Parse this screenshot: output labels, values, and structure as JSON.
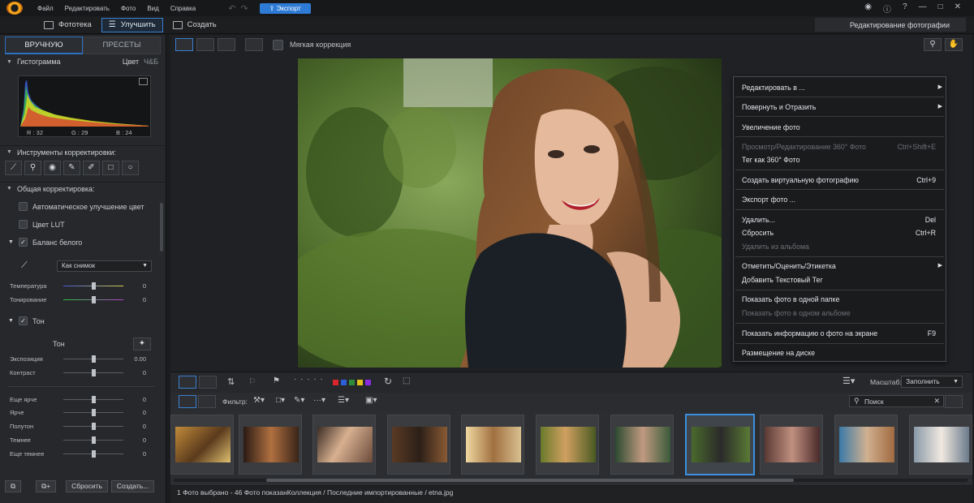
{
  "menu": [
    "Файл",
    "Редактировать",
    "Фото",
    "Вид",
    "Справка"
  ],
  "export_label": "Экспорт",
  "modes": {
    "library": "Фототека",
    "enhance": "Улучшить",
    "create": "Создать"
  },
  "mode_select": "Редактирование фотографии",
  "left": {
    "tabs": [
      "ВРУЧНУЮ",
      "ПРЕСЕТЫ"
    ],
    "histogram": {
      "title": "Гистограмма",
      "color": "Цвет",
      "bw": "Ч&Б",
      "r": "R : 32",
      "g": "G : 29",
      "b": "B : 24"
    },
    "tools_title": "Инструменты корректировки:",
    "general_title": "Общая корректировка:",
    "auto_enhance": "Автоматическое улучшение цвет",
    "lut": "Цвет LUT",
    "wb": "Баланс белого",
    "wb_preset": "Как снимок",
    "temperature": {
      "label": "Температура",
      "value": "0",
      "level": 0.5
    },
    "tint": {
      "label": "Тонирование",
      "value": "0",
      "level": 0.5
    },
    "tone": "Тон",
    "tone_sub": "Тон",
    "exposure": {
      "label": "Экспозиция",
      "value": "0.00",
      "level": 0.5
    },
    "contrast": {
      "label": "Контраст",
      "value": "0",
      "level": 0.5
    },
    "brighter2": {
      "label": "Еще ярче",
      "value": "0",
      "level": 0.5
    },
    "brighter": {
      "label": "Ярче",
      "value": "0",
      "level": 0.5
    },
    "midtone": {
      "label": "Полутон",
      "value": "0",
      "level": 0.5
    },
    "darker": {
      "label": "Темнее",
      "value": "0",
      "level": 0.5
    },
    "darker2": {
      "label": "Еще темнее",
      "value": "0",
      "level": 0.5
    },
    "reset": "Сбросить",
    "create": "Создать..."
  },
  "soft_correction": "Мягкая коррекция",
  "context_menu": {
    "edit_in": "Редактировать в ...",
    "rotate": "Повернуть и Отразить",
    "zoom": "Увеличение фото",
    "view360": "Просмотр/Редактирование 360° Фото",
    "view360_sc": "Ctrl+Shift+E",
    "tag360": "Тег как 360° Фото",
    "virtual": "Создать виртуальную фотографию",
    "virtual_sc": "Ctrl+9",
    "export": "Экспорт фото ...",
    "delete": "Удалить...",
    "delete_sc": "Del",
    "reset": "Сбросить",
    "reset_sc": "Ctrl+R",
    "remove_album": "Удалить из альбома",
    "mark": "Отметить/Оценить/Этикетка",
    "add_text_tag": "Добавить Текстовый Тег",
    "show_folder": "Показать фото в одной папке",
    "show_album": "Показать фото в одном альбоме",
    "show_info": "Показать информацию о фото на экране",
    "show_info_sc": "F9",
    "disk_location": "Размещение на диске"
  },
  "strip": {
    "scale_label": "Масштаб:",
    "scale_value": "Заполнить",
    "filter_label": "Фильтр:",
    "search_placeholder": "Поиск",
    "color_labels": [
      "#d8262c",
      "#2e5fd6",
      "#2e8b3a",
      "#e0c21c",
      "#8a2be2"
    ]
  },
  "status": "1 Фото выбрано - 46 Фото показанКоллекция / Последние импортированные / etna.jpg"
}
